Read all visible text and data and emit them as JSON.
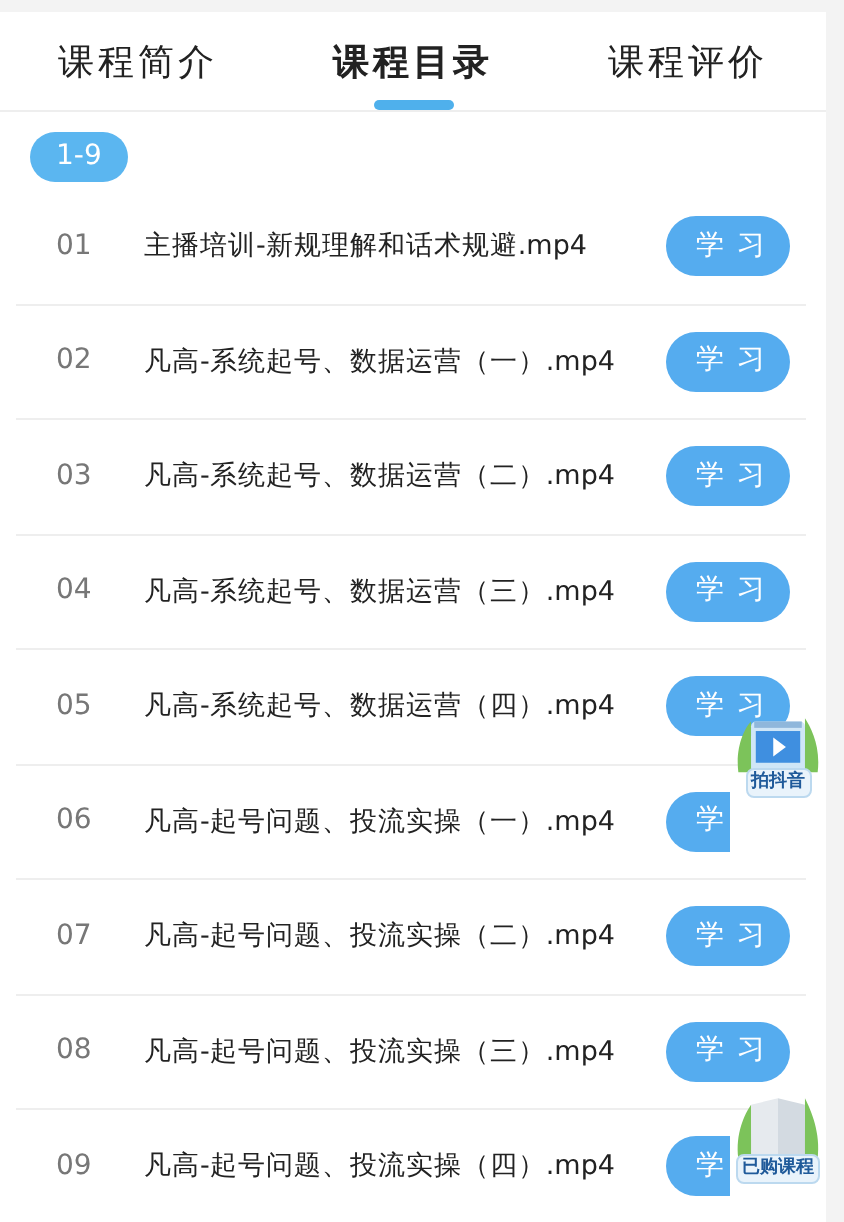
{
  "tabs": [
    {
      "label": "课程简介",
      "selected": false
    },
    {
      "label": "课程目录",
      "selected": true
    },
    {
      "label": "课程评价",
      "selected": false
    }
  ],
  "range_badge": "1-9",
  "lessons": [
    {
      "number": "01",
      "title": "主播培训-新规理解和话术规避.mp4",
      "button": "学 习"
    },
    {
      "number": "02",
      "title": "凡高-系统起号、数据运营（一）.mp4",
      "button": "学 习"
    },
    {
      "number": "03",
      "title": "凡高-系统起号、数据运营（二）.mp4",
      "button": "学 习"
    },
    {
      "number": "04",
      "title": "凡高-系统起号、数据运营（三）.mp4",
      "button": "学 习"
    },
    {
      "number": "05",
      "title": "凡高-系统起号、数据运营（四）.mp4",
      "button": "学 习"
    },
    {
      "number": "06",
      "title": "凡高-起号问题、投流实操（一）.mp4",
      "button": "学"
    },
    {
      "number": "07",
      "title": "凡高-起号问题、投流实操（二）.mp4",
      "button": "学 习"
    },
    {
      "number": "08",
      "title": "凡高-起号问题、投流实操（三）.mp4",
      "button": "学 习"
    },
    {
      "number": "09",
      "title": "凡高-起号问题、投流实操（四）.mp4",
      "button": "学"
    }
  ],
  "floating_buttons": [
    {
      "kind": "video",
      "label": "拍抖音"
    },
    {
      "kind": "book",
      "label": "已购课程"
    }
  ]
}
